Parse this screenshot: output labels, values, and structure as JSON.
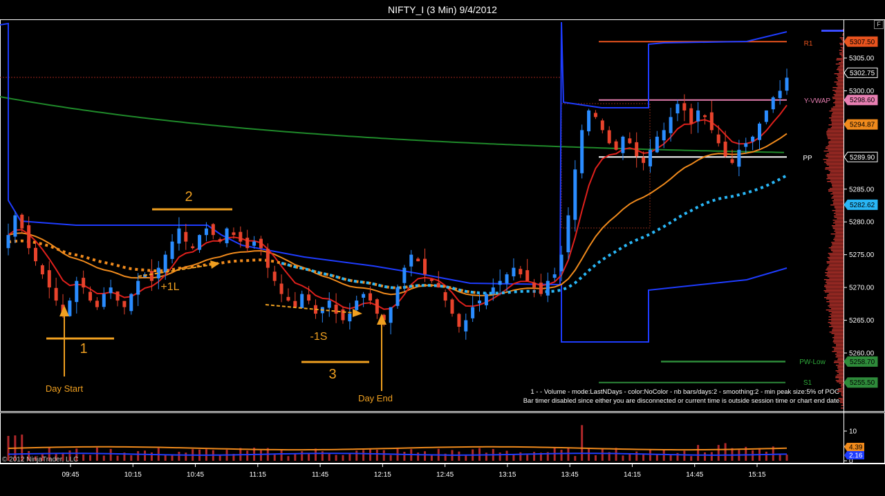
{
  "window": {
    "title": "NIFTY_I (3 Min)  9/4/2012",
    "f_button": "F"
  },
  "copyright": "© 2012 NinjaTrader, LLC",
  "notes": {
    "line1": "1 -  - Volume - mode:LastNDays  - color:NoColor - nb bars/days:2 - smoothing:2 - min peak size:5% of POC",
    "line2": "Bar timer disabled since either you are disconnected or current time is outside session time or chart end date"
  },
  "annotations": {
    "a1": "1",
    "a2": "2",
    "a3": "3",
    "day_start": "Day Start",
    "day_end": "Day End",
    "plus1l": "+1L",
    "minus1s": "-1S"
  },
  "level_labels": {
    "r1": "R1",
    "yvwap": "Y-VWAP",
    "pp": "PP",
    "pwlow": "PW-Low",
    "s1": "S1"
  },
  "price_axis": {
    "ticks": [
      "5305.00",
      "5300.00",
      "5295.00",
      "5290.00",
      "5285.00",
      "5280.00",
      "5275.00",
      "5270.00",
      "5265.00",
      "5260.00"
    ],
    "badges": [
      {
        "label": "5307.50",
        "price": 5307.5,
        "color": "#e8531e"
      },
      {
        "label": "5302.75",
        "price": 5302.75,
        "color": "#000000"
      },
      {
        "label": "5298.60",
        "price": 5298.6,
        "color": "#e87fb2"
      },
      {
        "label": "5294.87",
        "price": 5294.87,
        "color": "#f08a1c"
      },
      {
        "label": "5289.90",
        "price": 5289.9,
        "color": "#000000"
      },
      {
        "label": "5282.62",
        "price": 5282.62,
        "color": "#29b6f6"
      },
      {
        "label": "5258.70",
        "price": 5258.7,
        "color": "#2e8b3a"
      },
      {
        "label": "5255.50",
        "price": 5255.5,
        "color": "#2e8b3a"
      }
    ]
  },
  "volume_axis": {
    "ticks": [
      "10",
      "5",
      "0"
    ],
    "badges": [
      {
        "label": "4.39",
        "color": "#f08a1c"
      },
      {
        "label": "2.16",
        "color": "#1e3cff"
      }
    ]
  },
  "time_axis": [
    "09:45",
    "10:15",
    "10:45",
    "11:15",
    "11:45",
    "12:15",
    "12:45",
    "13:15",
    "13:45",
    "14:15",
    "14:45",
    "15:15"
  ],
  "chart_data": {
    "type": "candlestick",
    "title": "NIFTY_I (3 Min)  9/4/2012",
    "ylim": [
      5254,
      5312
    ],
    "levels": {
      "R1": 5307.5,
      "Y-VWAP": 5298.6,
      "PP": 5289.9,
      "PW-Low": 5258.7,
      "S1": 5255.5
    },
    "close_path": [
      5278,
      5281,
      5279,
      5276,
      5274,
      5272,
      5270,
      5268,
      5266,
      5268,
      5271,
      5270,
      5268,
      5267,
      5269,
      5270,
      5268,
      5267,
      5269,
      5271,
      5272,
      5271,
      5273,
      5275,
      5277,
      5279,
      5277,
      5276,
      5278,
      5279,
      5278,
      5277,
      5279,
      5278,
      5277,
      5276,
      5277,
      5276,
      5273,
      5271,
      5269,
      5268,
      5267,
      5269,
      5268,
      5266,
      5267,
      5268,
      5266,
      5265,
      5266,
      5268,
      5269,
      5268,
      5266,
      5265,
      5267,
      5270,
      5273,
      5275,
      5274,
      5272,
      5271,
      5270,
      5268,
      5266,
      5264,
      5265,
      5267,
      5268,
      5269,
      5270,
      5271,
      5272,
      5273,
      5272,
      5271,
      5270,
      5269,
      5271,
      5272,
      5275,
      5281,
      5288,
      5294,
      5297,
      5296,
      5294,
      5292,
      5291,
      5293,
      5292,
      5290,
      5289,
      5291,
      5293,
      5294,
      5296,
      5298,
      5297,
      5295,
      5297,
      5296,
      5294,
      5292,
      5290,
      5289,
      5291,
      5292,
      5293,
      5295,
      5297,
      5299,
      5300,
      5302
    ],
    "volume_series": [
      {
        "name": "4.39",
        "color": "#f08a1c"
      },
      {
        "name": "2.16",
        "color": "#1e3cff"
      }
    ]
  }
}
